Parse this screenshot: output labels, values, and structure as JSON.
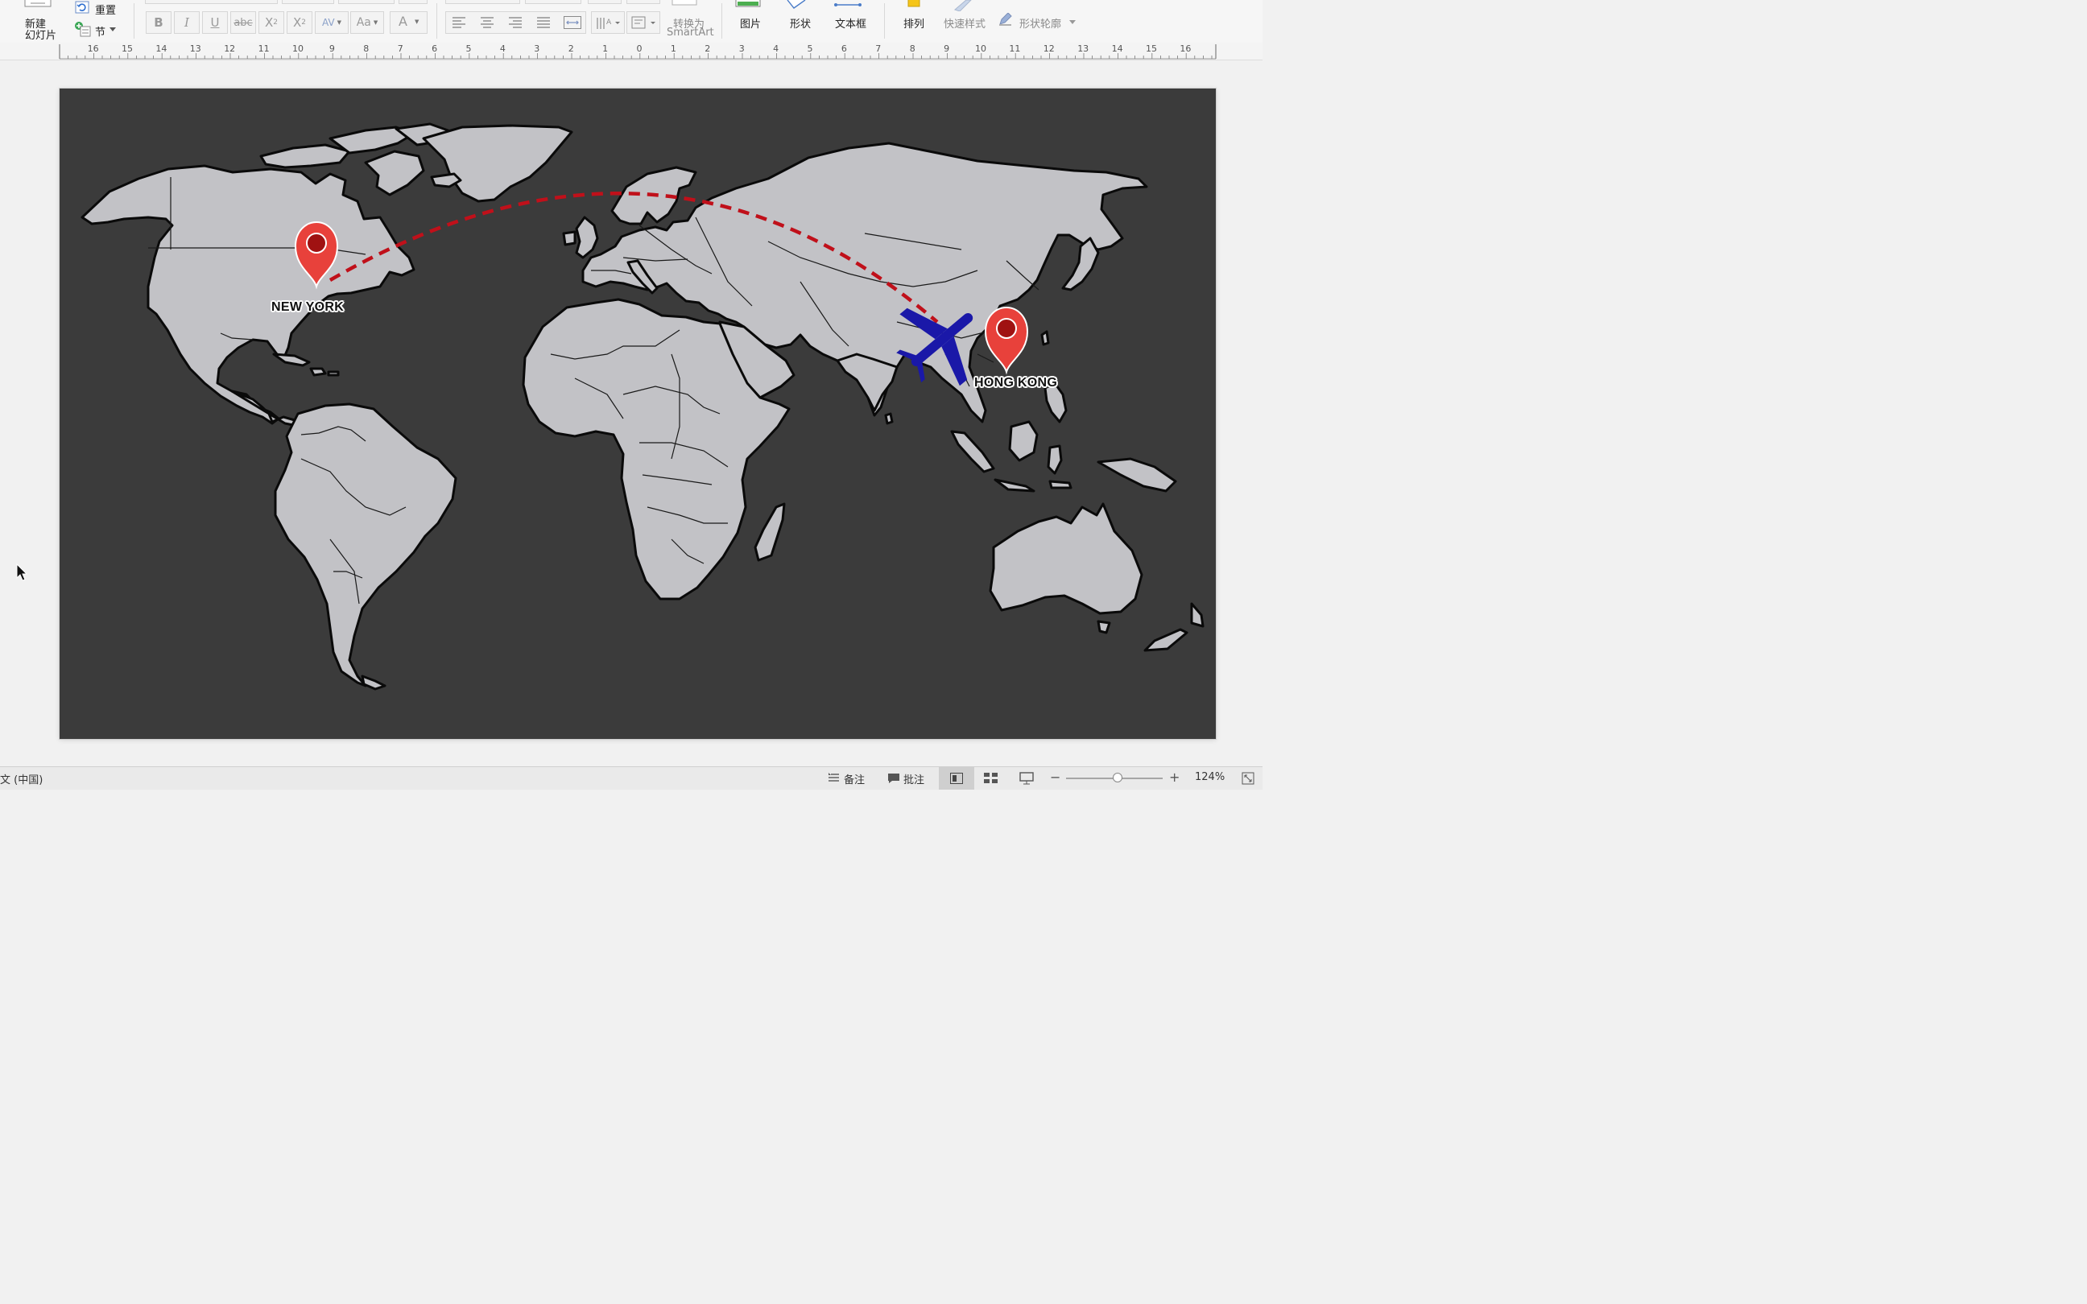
{
  "ribbon": {
    "new_slide_line1": "新建",
    "new_slide_line2": "幻灯片",
    "reset_label": "重置",
    "section_label": "节",
    "format": {
      "bold": "B",
      "italic": "I",
      "underline": "U",
      "strikethrough": "abc",
      "superscript_base": "X",
      "superscript_exp": "2",
      "subscript_base": "X",
      "subscript_exp": "2",
      "char_spacing": "AV",
      "change_case": "Aa",
      "font_color": "A"
    },
    "convert_smartart_line1": "转换为",
    "convert_smartart_line2": "SmartArt",
    "picture_label": "图片",
    "shape_label": "形状",
    "textbox_label": "文本框",
    "arrange_label": "排列",
    "quick_styles_label": "快速样式",
    "shape_outline_label": "形状轮廓"
  },
  "ruler": {
    "labels": [
      "16",
      "15",
      "14",
      "13",
      "12",
      "11",
      "10",
      "9",
      "8",
      "7",
      "6",
      "5",
      "4",
      "3",
      "2",
      "1",
      "0",
      "1",
      "2",
      "3",
      "4",
      "5",
      "6",
      "7",
      "8",
      "9",
      "10",
      "11",
      "12",
      "13",
      "14",
      "15",
      "16"
    ]
  },
  "slide": {
    "background": "#3b3b3b",
    "land_color": "#c2c2c6",
    "route_color": "#c0101a",
    "plane_color": "#1a18a8",
    "pin_color": "#e8413b",
    "origin_city": "NEW YORK",
    "destination_city": "HONG KONG"
  },
  "statusbar": {
    "language": "文 (中国)",
    "notes_label": "备注",
    "comments_label": "批注",
    "zoom_level": "124%"
  }
}
